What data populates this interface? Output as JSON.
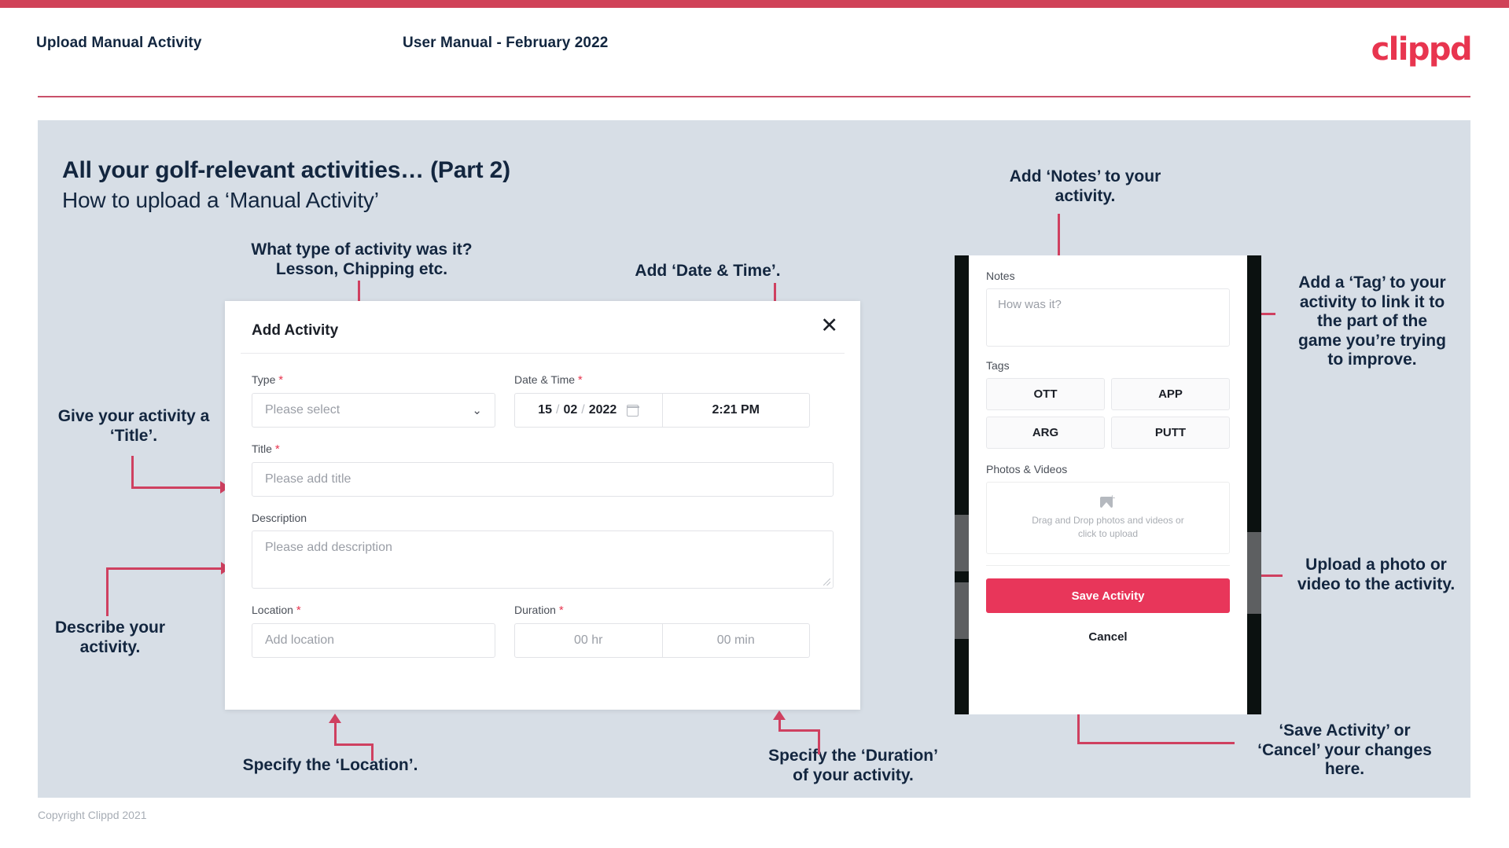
{
  "header": {
    "title": "Upload Manual Activity",
    "subtitle": "User Manual - February 2022",
    "brand": "clippd"
  },
  "slide": {
    "heading": "All your golf-relevant activities… (Part 2)",
    "subheading": "How to upload a ‘Manual Activity’"
  },
  "footer": {
    "copyright": "Copyright Clippd 2021"
  },
  "annotations": {
    "type": "What type of activity was it?\nLesson, Chipping etc.",
    "date_time": "Add ‘Date & Time’.",
    "title": "Give your activity a\n‘Title’.",
    "description": "Describe your\nactivity.",
    "location": "Specify the ‘Location’.",
    "duration": "Specify the ‘Duration’\nof your activity.",
    "notes": "Add ‘Notes’ to your\nactivity.",
    "tags": "Add a ‘Tag’ to your\nactivity to link it to\nthe part of the\ngame you’re trying\nto improve.",
    "photos": "Upload a photo or\nvideo to the activity.",
    "save_cancel": "‘Save Activity’ or\n‘Cancel’ your changes\nhere."
  },
  "dialog": {
    "title": "Add Activity",
    "close_icon": "✕",
    "fields": {
      "type": {
        "label": "Type",
        "required": "*",
        "placeholder": "Please select",
        "chevron": "⌄"
      },
      "datetime": {
        "label": "Date & Time",
        "required": "*",
        "day": "15",
        "sep1": "/",
        "month": "02",
        "sep2": "/",
        "year": "2022",
        "time": "2:21 PM"
      },
      "title": {
        "label": "Title",
        "required": "*",
        "placeholder": "Please add title"
      },
      "description": {
        "label": "Description",
        "placeholder": "Please add description"
      },
      "location": {
        "label": "Location",
        "required": "*",
        "placeholder": "Add location"
      },
      "duration": {
        "label": "Duration",
        "required": "*",
        "hours": "00 hr",
        "minutes": "00 min"
      }
    }
  },
  "phone": {
    "notes": {
      "label": "Notes",
      "placeholder": "How was it?"
    },
    "tags": {
      "label": "Tags",
      "items": [
        "OTT",
        "APP",
        "ARG",
        "PUTT"
      ]
    },
    "photos": {
      "label": "Photos & Videos",
      "dropzone_line1": "Drag and Drop photos and videos or",
      "dropzone_line2": "click to upload"
    },
    "save_label": "Save Activity",
    "cancel_label": "Cancel"
  },
  "colors": {
    "brand_red": "#e8354f",
    "accent_pink": "#e8365a",
    "arrow": "#cf4060",
    "panel_bg": "#d7dee6",
    "text_dark": "#13263f"
  }
}
